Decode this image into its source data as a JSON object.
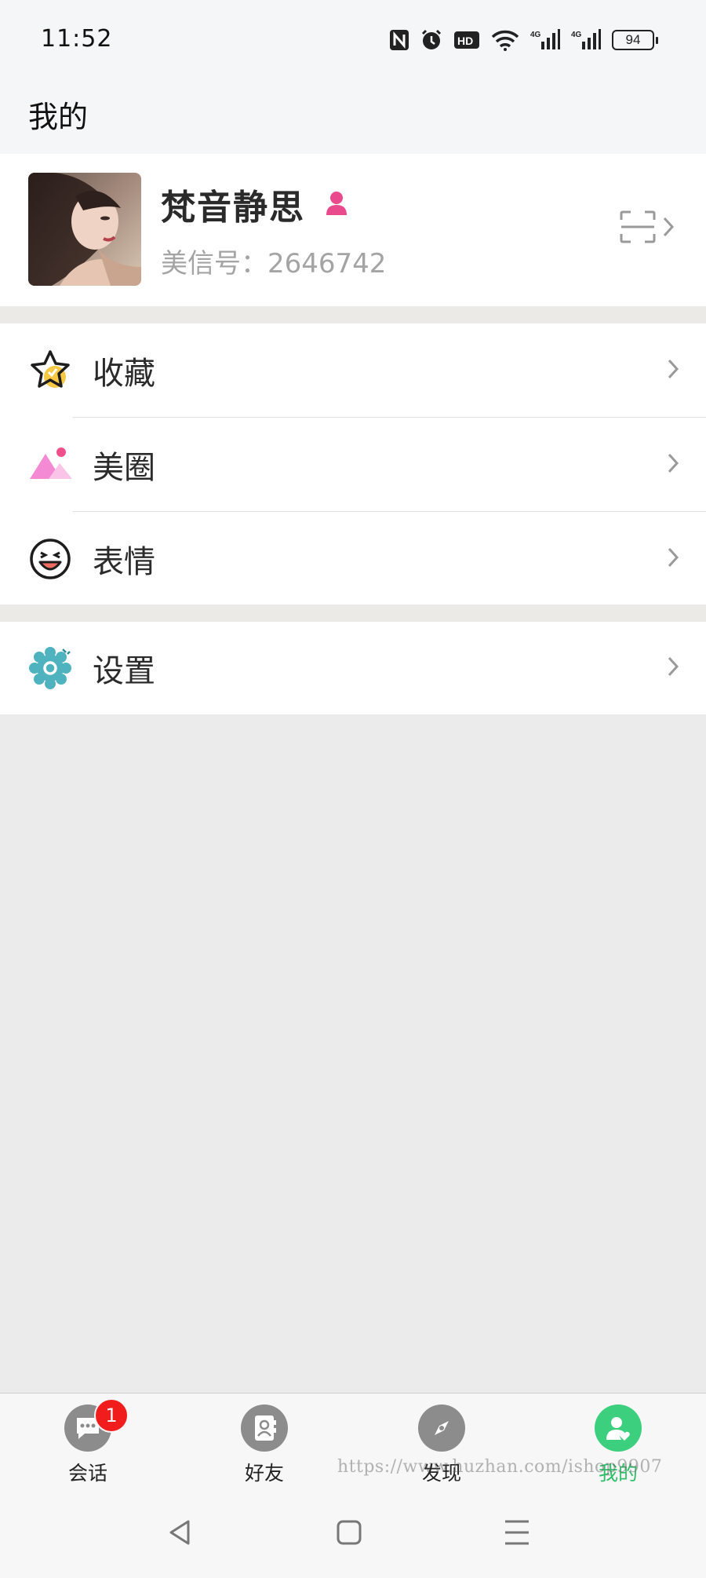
{
  "status_bar": {
    "time": "11:52",
    "battery": "94",
    "icons": [
      "nfc-icon",
      "alarm-icon",
      "hd-voice-icon",
      "wifi-icon",
      "signal-4g-icon",
      "signal-4g-icon"
    ]
  },
  "header": {
    "title": "我的"
  },
  "profile": {
    "name": "梵音静思",
    "id_label": "美信号：2646742",
    "gender_icon_color": "#e84a8d"
  },
  "menu": {
    "group1": [
      {
        "label": "收藏",
        "icon": "star-icon"
      },
      {
        "label": "美圈",
        "icon": "moments-icon"
      },
      {
        "label": "表情",
        "icon": "emoji-icon"
      }
    ],
    "group2": [
      {
        "label": "设置",
        "icon": "settings-icon"
      }
    ]
  },
  "bottom_nav": {
    "tabs": [
      {
        "label": "会话",
        "icon": "chat-icon",
        "badge": "1",
        "active": false
      },
      {
        "label": "好友",
        "icon": "contacts-icon",
        "active": false
      },
      {
        "label": "发现",
        "icon": "compass-icon",
        "active": false
      },
      {
        "label": "我的",
        "icon": "me-icon",
        "active": true
      }
    ],
    "active_color": "#3ccf7d"
  },
  "watermark": "https://www.huzhan.com/ishop9907",
  "colors": {
    "accent": "#3ccf7d",
    "badge": "#f11d1d",
    "settings_icon": "#4fb3bf",
    "moments_icon": "#f48ad3"
  }
}
